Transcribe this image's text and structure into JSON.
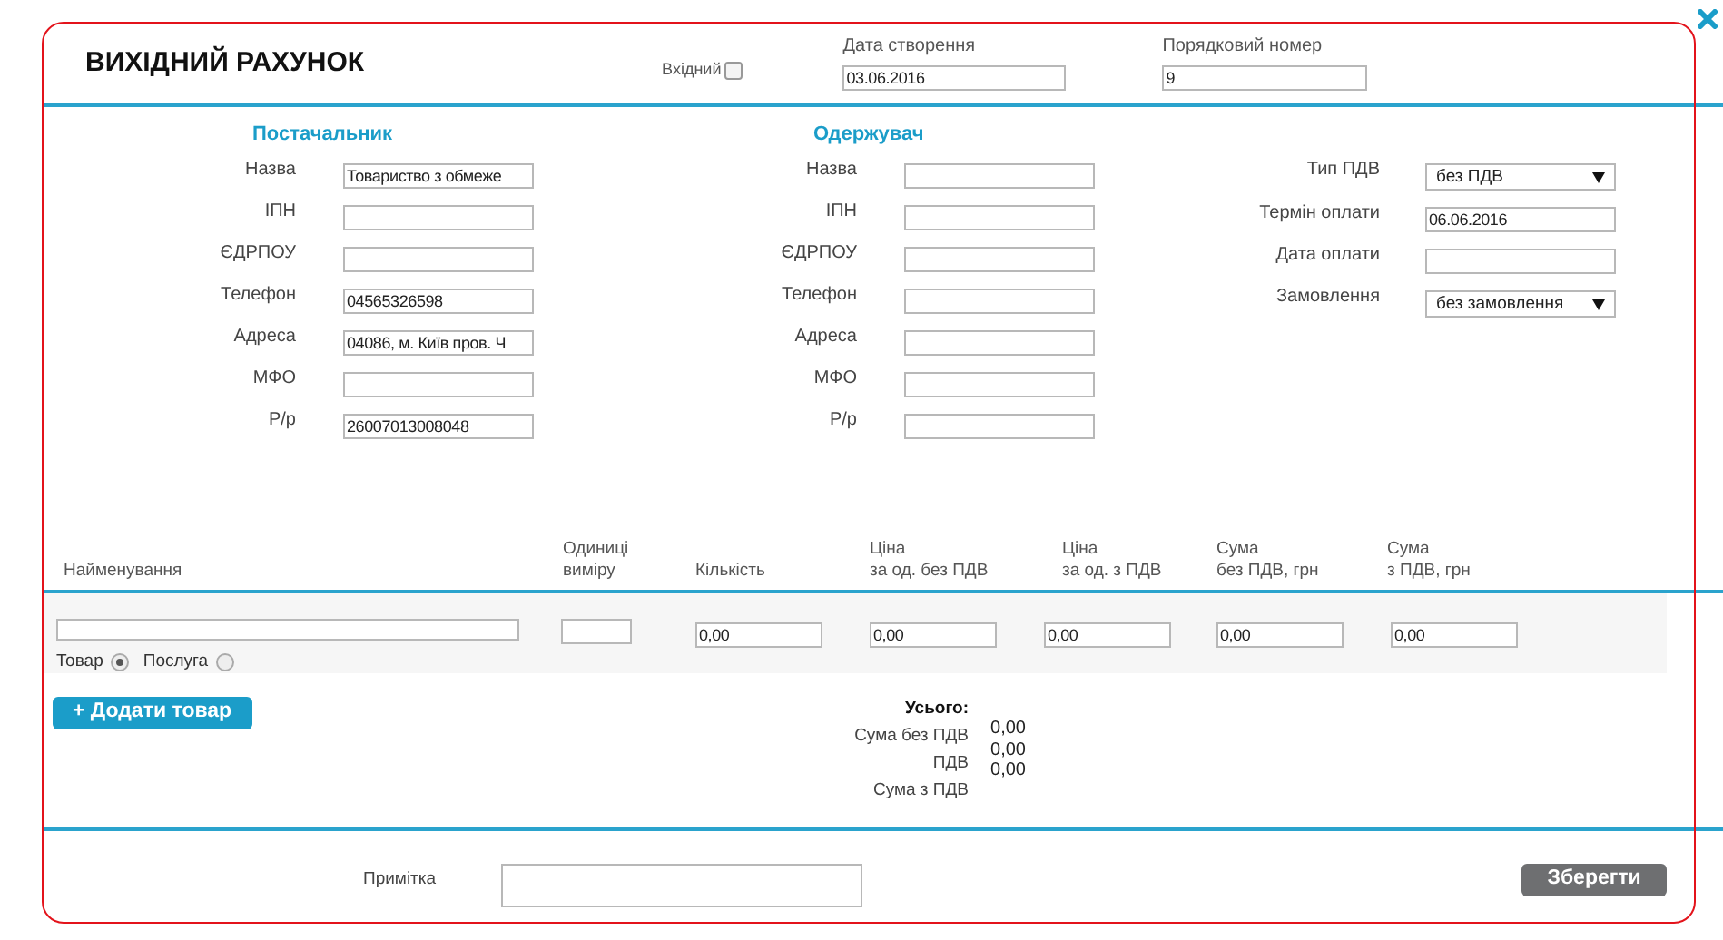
{
  "dialog": {
    "title": "ВИХІДНИЙ РАХУНОК",
    "incoming": {
      "label": "Вхідний",
      "checked": false
    },
    "created_date": {
      "label": "Дата створення",
      "value": "03.06.2016"
    },
    "sequence_number": {
      "label": "Порядковий номер",
      "value": "9"
    }
  },
  "supplier": {
    "heading": "Постачальник",
    "fields": [
      {
        "label": "Назва",
        "value": "Товариство з обмеже"
      },
      {
        "label": "ІПН"
      },
      {
        "label": "ЄДРПОУ"
      },
      {
        "label": "Телефон",
        "value": "04565326598"
      },
      {
        "label": "Адреса",
        "value": "04086, м. Київ пров. Ч"
      },
      {
        "label": "МФО"
      },
      {
        "label": "Р/р",
        "value": "26007013008048"
      }
    ]
  },
  "recipient": {
    "heading": "Одержувач",
    "fields": [
      {
        "label": "Назва"
      },
      {
        "label": "ІПН"
      },
      {
        "label": "ЄДРПОУ"
      },
      {
        "label": "Телефон"
      },
      {
        "label": "Адреса"
      },
      {
        "label": "МФО"
      },
      {
        "label": "Р/р"
      }
    ]
  },
  "payment": {
    "fields": [
      {
        "kind": "select",
        "label": "Тип ПДВ",
        "value": "без ПДВ"
      },
      {
        "kind": "input",
        "label": "Термін оплати",
        "value": "06.06.2016"
      },
      {
        "kind": "input",
        "label": "Дата оплати"
      },
      {
        "kind": "select",
        "label": "Замовлення",
        "value": "без замовлення"
      }
    ]
  },
  "items": {
    "columns": [
      [
        "Найменування"
      ],
      [
        "Одиниці",
        "виміру"
      ],
      [
        "Кількість"
      ],
      [
        "Ціна",
        "за од. без ПДВ"
      ],
      [
        "Ціна",
        "за од. з ПДВ"
      ],
      [
        "Сума",
        "без ПДВ, грн"
      ],
      [
        "Сума",
        "з ПДВ, грн"
      ]
    ],
    "row": {
      "amounts": [
        "0,00",
        "0,00",
        "0,00",
        "0,00",
        "0,00"
      ],
      "types": [
        {
          "label": "Товар",
          "selected": true
        },
        {
          "label": "Послуга",
          "selected": false
        }
      ]
    }
  },
  "add_button": "+ Додати товар",
  "totals": {
    "heading": "Усього:",
    "labels": [
      "Сума без ПДВ",
      "ПДВ",
      "Сума з ПДВ"
    ],
    "values": [
      "0,00",
      "0,00",
      "0,00"
    ]
  },
  "note": {
    "label": "Примітка"
  },
  "save_button": "Зберегти"
}
